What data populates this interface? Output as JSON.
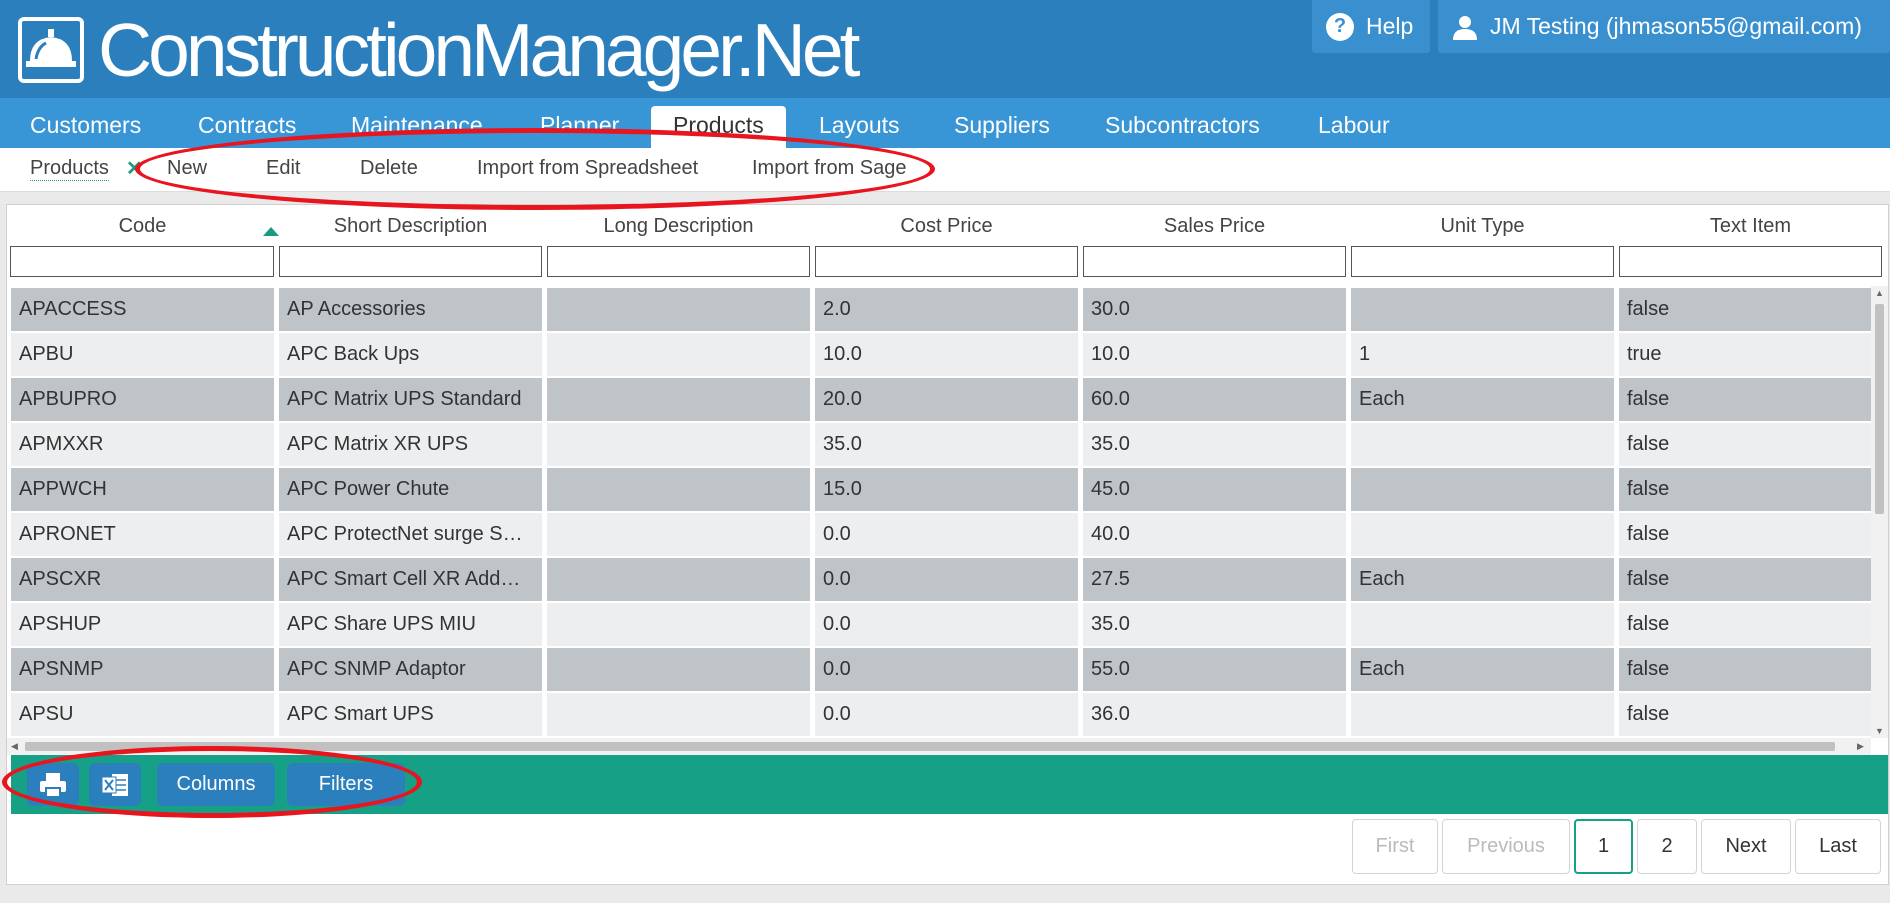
{
  "header": {
    "app_title": "ConstructionManager.Net",
    "help_label": "Help",
    "user_label": "JM Testing (jhmason55@gmail.com)"
  },
  "main_nav": [
    "Customers",
    "Contracts",
    "Maintenance",
    "Planner",
    "Products",
    "Layouts",
    "Suppliers",
    "Subcontractors",
    "Labour"
  ],
  "main_nav_active": "Products",
  "sub_nav": {
    "breadcrumb": "Products",
    "actions": [
      "New",
      "Edit",
      "Delete",
      "Import from Spreadsheet",
      "Import from Sage"
    ]
  },
  "grid": {
    "columns": [
      "Code",
      "Short Description",
      "Long Description",
      "Cost Price",
      "Sales Price",
      "Unit Type",
      "Text Item"
    ],
    "sorted_column": "Code",
    "rows": [
      [
        "APACCESS",
        "AP Accessories",
        "",
        "2.0",
        "30.0",
        "",
        "false"
      ],
      [
        "APBU",
        "APC Back Ups",
        "",
        "10.0",
        "10.0",
        "1",
        "true"
      ],
      [
        "APBUPRO",
        "APC Matrix UPS Standard",
        "",
        "20.0",
        "60.0",
        "Each",
        "false"
      ],
      [
        "APMXXR",
        "APC Matrix XR UPS",
        "",
        "35.0",
        "35.0",
        "",
        "false"
      ],
      [
        "APPWCH",
        "APC Power Chute",
        "",
        "15.0",
        "45.0",
        "",
        "false"
      ],
      [
        "APRONET",
        "APC ProtectNet surge S…",
        "",
        "0.0",
        "40.0",
        "",
        "false"
      ],
      [
        "APSCXR",
        "APC Smart Cell XR Add…",
        "",
        "0.0",
        "27.5",
        "Each",
        "false"
      ],
      [
        "APSHUP",
        "APC Share UPS MIU",
        "",
        "0.0",
        "35.0",
        "",
        "false"
      ],
      [
        "APSNMP",
        "APC SNMP Adaptor",
        "",
        "0.0",
        "55.0",
        "Each",
        "false"
      ],
      [
        "APSU",
        "APC Smart UPS",
        "",
        "0.0",
        "36.0",
        "",
        "false"
      ]
    ]
  },
  "toolbar": {
    "print_icon": "printer-icon",
    "excel_icon": "excel-icon",
    "columns_label": "Columns",
    "filters_label": "Filters",
    "color": "#16a085"
  },
  "pagination": {
    "first": "First",
    "previous": "Previous",
    "pages": [
      "1",
      "2"
    ],
    "current_page": "1",
    "next": "Next",
    "last": "Last"
  },
  "colors": {
    "header_bg": "#2c7fbd",
    "nav_bg": "#3996d6",
    "annotation": "#e8141e"
  }
}
